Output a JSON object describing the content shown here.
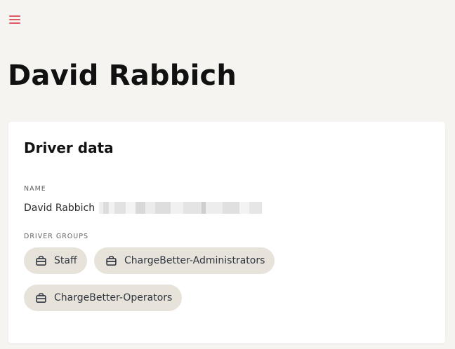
{
  "header": {
    "menu_icon": "hamburger-menu-icon",
    "accent_color": "#e05a66"
  },
  "page": {
    "title": "David Rabbich"
  },
  "driver_card": {
    "title": "Driver data",
    "name_label": "NAME",
    "name_value": "David Rabbich",
    "groups_label": "DRIVER GROUPS",
    "group_icon": "briefcase-icon",
    "groups": [
      "Staff",
      "ChargeBetter-Administrators",
      "ChargeBetter-Operators"
    ]
  }
}
